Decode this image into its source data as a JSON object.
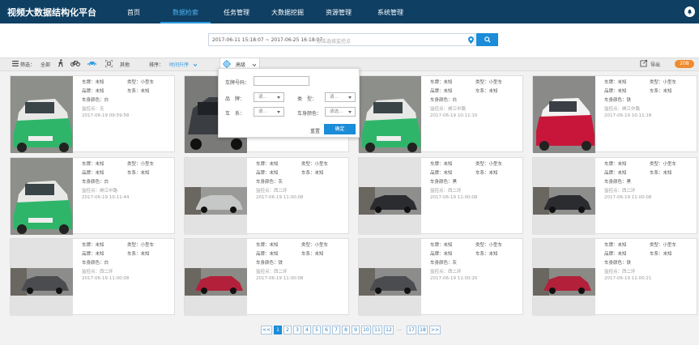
{
  "app": {
    "title": "视频大数据结构化平台"
  },
  "nav": [
    {
      "label": "首页",
      "active": false
    },
    {
      "label": "数据检索",
      "active": true
    },
    {
      "label": "任务管理",
      "active": false
    },
    {
      "label": "大数据挖掘",
      "active": false
    },
    {
      "label": "资源管理",
      "active": false
    },
    {
      "label": "系统管理",
      "active": false
    }
  ],
  "search": {
    "range": "2017-06-11 15:18:07  ~ 2017-06-25 16:18:07",
    "placeholder": "点击选择监控点"
  },
  "filter": {
    "label": "筛选：",
    "all": "全部",
    "other": "其他",
    "sort_label": "排序：",
    "sort_value": "时间升序",
    "advanced": "高级",
    "export": "导出",
    "count": "208"
  },
  "popup": {
    "plate_label": "车牌号码：",
    "brand_label": "品　牌：",
    "brand_value": "请...",
    "type_label": "类　型：",
    "type_value": "请...",
    "series_label": "车　系：",
    "series_value": "请...",
    "color_label": "车身颜色：",
    "color_value": "请选...",
    "reset": "重置",
    "ok": "确定"
  },
  "cards": [
    {
      "l1": "车牌：未知",
      "t1": "类型：小型车",
      "l2": "品牌：未知",
      "t2": "车系：未知",
      "color": "车身颜色：白",
      "loc": "监控点：无",
      "time": "2017-06-19 09:59:58",
      "img": "taxi-green"
    },
    {
      "l1": "",
      "t1": "",
      "l2": "",
      "t2": "",
      "color": "",
      "loc": "",
      "time": "",
      "img": "dark-car"
    },
    {
      "l1": "车牌：未知",
      "t1": "类型：小型车",
      "l2": "品牌：未知",
      "t2": "车系：未知",
      "color": "车身颜色：白",
      "loc": "监控点：闸江中路",
      "time": "2017-06-19 10:11:10",
      "img": "taxi-green"
    },
    {
      "l1": "车牌：未知",
      "t1": "类型：小型车",
      "l2": "品牌：未知",
      "t2": "车系：未知",
      "color": "车身颜色：铁",
      "loc": "监控点：闸江中路",
      "time": "2017-06-19 10:11:18",
      "img": "taxi-red"
    },
    {
      "l1": "车牌：未知",
      "t1": "类型：小型车",
      "l2": "品牌：未知",
      "t2": "车系：未知",
      "color": "车身颜色：白",
      "loc": "监控点：闸江中路",
      "time": "2017-06-19 10:11:44",
      "img": "taxi-green"
    },
    {
      "l1": "车牌：未知",
      "t1": "类型：小型车",
      "l2": "品牌：未知",
      "t2": "车系：未知",
      "color": "车身颜色：灰",
      "loc": "监控点：西二环",
      "time": "2017-06-19 11:00:08",
      "img": "street-silver"
    },
    {
      "l1": "车牌：未知",
      "t1": "类型：小型车",
      "l2": "品牌：未知",
      "t2": "车系：未知",
      "color": "车身颜色：黑",
      "loc": "监控点：西二环",
      "time": "2017-06-19 11:00:08",
      "img": "street-black"
    },
    {
      "l1": "车牌：未知",
      "t1": "类型：小型车",
      "l2": "品牌：未知",
      "t2": "车系：未知",
      "color": "车身颜色：黑",
      "loc": "监控点：西二环",
      "time": "2017-06-19 11:00:08",
      "img": "street-black"
    },
    {
      "l1": "车牌：未知",
      "t1": "类型：小型车",
      "l2": "品牌：未知",
      "t2": "车系：未知",
      "color": "车身颜色：白",
      "loc": "监控点：西二环",
      "time": "2017-06-19 11:00:08",
      "img": "street-dark"
    },
    {
      "l1": "车牌：未知",
      "t1": "类型：小型车",
      "l2": "品牌：未知",
      "t2": "车系：未知",
      "color": "车身颜色：铁",
      "loc": "监控点：西二环",
      "time": "2017-06-19 11:00:08",
      "img": "street-red"
    },
    {
      "l1": "车牌：未知",
      "t1": "类型：小型车",
      "l2": "品牌：未知",
      "t2": "车系：未知",
      "color": "车身颜色：灰",
      "loc": "监控点：西二环",
      "time": "2017-06-19 11:00:20",
      "img": "street-dark"
    },
    {
      "l1": "车牌：未知",
      "t1": "类型：小型车",
      "l2": "品牌：未知",
      "t2": "车系：未知",
      "color": "车身颜色：铁",
      "loc": "监控点：西二环",
      "time": "2017-06-19 11:00:21",
      "img": "street-red"
    }
  ],
  "pagination": {
    "prev": "<<",
    "pages": [
      "1",
      "2",
      "3",
      "4",
      "5",
      "6",
      "7",
      "8",
      "9",
      "10",
      "11",
      "12"
    ],
    "ellipsis": "...",
    "tail": [
      "17",
      "18"
    ],
    "next": ">>",
    "current": "1"
  },
  "colors": {
    "header": "#0f3f63",
    "accent": "#1a8cd8",
    "badge": "#f08a2c"
  }
}
